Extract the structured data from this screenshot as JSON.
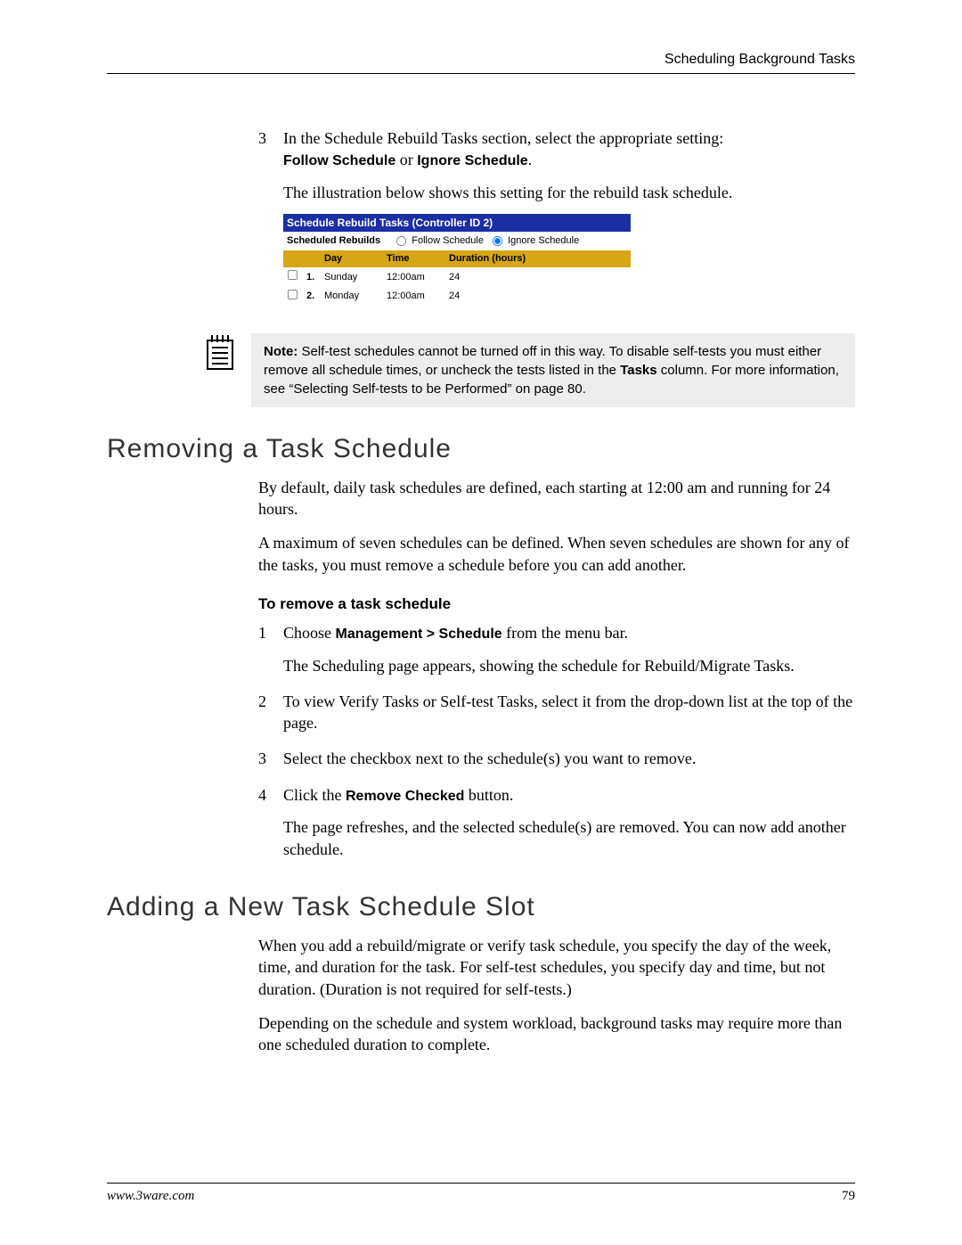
{
  "header": {
    "chapter": "Scheduling Background Tasks"
  },
  "intro_step": {
    "num": "3",
    "line1_a": "In the Schedule Rebuild Tasks section, select the appropriate setting: ",
    "bold1": "Follow Schedule",
    "mid": " or ",
    "bold2": "Ignore Schedule",
    "tail": ".",
    "caption": "The illustration below shows this setting for the rebuild task schedule."
  },
  "sched": {
    "title": "Schedule Rebuild Tasks (Controller ID 2)",
    "label": "Scheduled Rebuilds",
    "opt_follow": "Follow Schedule",
    "opt_ignore": "Ignore Schedule",
    "head_day": "Day",
    "head_time": "Time",
    "head_dur": "Duration (hours)",
    "rows": [
      {
        "idx": "1.",
        "day": "Sunday",
        "time": "12:00am",
        "dur": "24"
      },
      {
        "idx": "2.",
        "day": "Monday",
        "time": "12:00am",
        "dur": "24"
      }
    ]
  },
  "note": {
    "label": "Note:",
    "t1": " Self-test schedules cannot be turned off in this way. To disable self-tests you must either remove all schedule times, or uncheck the tests listed in the ",
    "bold": "Tasks",
    "t2": " column. For more information, see “Selecting Self-tests to be Performed” on page 80."
  },
  "removing": {
    "title": "Removing a Task Schedule",
    "p1": "By default, daily task schedules are defined, each starting at 12:00 am and running for 24 hours.",
    "p2": "A maximum of seven schedules can be defined. When seven schedules are shown for any of the tasks, you must remove a schedule before you can add another.",
    "subhead": "To remove a task schedule",
    "steps": {
      "s1n": "1",
      "s1a": "Choose ",
      "s1b": "Management > Schedule",
      "s1c": " from the menu bar.",
      "s1p": "The Scheduling page appears, showing the schedule for Rebuild/Migrate Tasks.",
      "s2n": "2",
      "s2": "To view Verify Tasks or Self-test Tasks, select it from the drop-down list at the top of the page.",
      "s3n": "3",
      "s3": "Select the checkbox next to the schedule(s) you want to remove.",
      "s4n": "4",
      "s4a": "Click the ",
      "s4b": "Remove Checked",
      "s4c": " button.",
      "s4p": "The page refreshes, and the selected schedule(s) are removed. You can now add another schedule."
    }
  },
  "adding": {
    "title": "Adding a New Task Schedule Slot",
    "p1": "When you add a rebuild/migrate or verify task schedule, you specify the day of the week, time, and duration for the task. For self-test schedules, you specify day and time, but not duration. (Duration is not required for self-tests.)",
    "p2": "Depending on the schedule and system workload, background tasks may require more than one scheduled duration to complete."
  },
  "footer": {
    "url": "www.3ware.com",
    "page": "79"
  }
}
